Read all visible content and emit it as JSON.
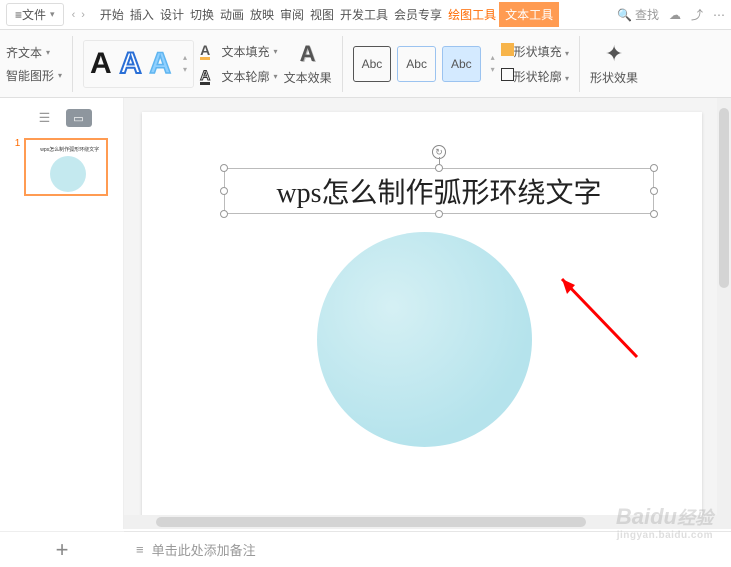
{
  "menu": {
    "file": "文件",
    "tabs": [
      "开始",
      "插入",
      "设计",
      "切换",
      "动画",
      "放映",
      "审阅",
      "视图",
      "开发工具",
      "会员专享",
      "绘图工具",
      "文本工具"
    ],
    "search": "查找"
  },
  "ribbon": {
    "align_text": "齐文本",
    "smart_graphic": "智能图形",
    "text_fill": "文本填充",
    "text_outline": "文本轮廓",
    "text_effects": "文本效果",
    "abc": "Abc",
    "shape_fill": "形状填充",
    "shape_outline": "形状轮廓",
    "shape_effects": "形状效果",
    "art_letter": "A"
  },
  "slide": {
    "number": "1",
    "textbox_content": "wps怎么制作弧形环绕文字",
    "notes_placeholder": "单击此处添加备注"
  },
  "footer": {
    "add": "+"
  },
  "watermark": {
    "brand": "Baidu",
    "sub": "经验"
  }
}
